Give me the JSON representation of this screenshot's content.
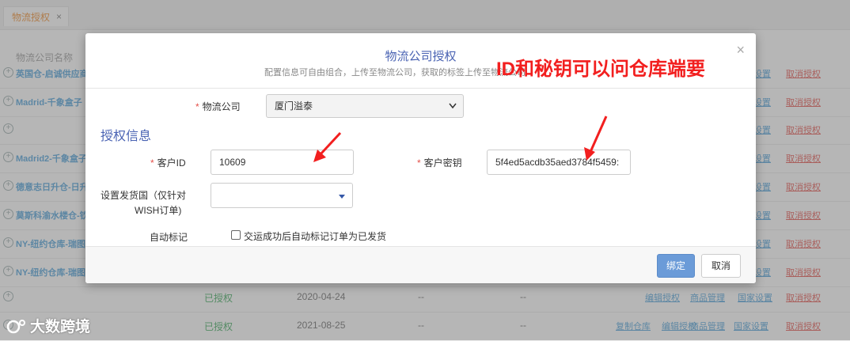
{
  "tab": {
    "label": "物流授权",
    "close_glyph": "×"
  },
  "background": {
    "header_name": "物流公司名称",
    "rows": [
      {
        "name": "英国仓-启诚供应商",
        "auth": "",
        "date": "",
        "d1": "",
        "d2": "",
        "links": [
          "国家设置",
          "取消授权"
        ]
      },
      {
        "name": "Madrid-千象盒子",
        "auth": "",
        "date": "",
        "d1": "",
        "d2": "",
        "links": [
          "国家设置",
          "取消授权"
        ]
      },
      {
        "name": "",
        "auth": "",
        "date": "",
        "d1": "",
        "d2": "",
        "links": [
          "国家设置",
          "取消授权"
        ]
      },
      {
        "name": "Madrid2-千象盒子",
        "auth": "",
        "date": "",
        "d1": "",
        "d2": "",
        "links": [
          "国家设置",
          "取消授权"
        ]
      },
      {
        "name": "德意志日升仓-日升",
        "auth": "",
        "date": "",
        "d1": "",
        "d2": "",
        "links": [
          "国家设置",
          "取消授权"
        ]
      },
      {
        "name": "莫斯科渝水楼仓-钦",
        "auth": "",
        "date": "",
        "d1": "",
        "d2": "",
        "links": [
          "国家设置",
          "取消授权"
        ]
      },
      {
        "name": "NY-纽约仓库-瑞图",
        "auth": "",
        "date": "",
        "d1": "",
        "d2": "",
        "links": [
          "国家设置",
          "取消授权"
        ]
      },
      {
        "name": "NY-纽约仓库-瑞图",
        "auth": "",
        "date": "",
        "d1": "",
        "d2": "",
        "links": [
          "国家设置",
          "取消授权"
        ]
      },
      {
        "name": "",
        "auth": "已授权",
        "date": "2020-04-24",
        "d1": "--",
        "d2": "--",
        "links": [
          "编辑授权",
          "商品管理",
          "国家设置",
          "取消授权"
        ]
      },
      {
        "name": "",
        "auth": "已授权",
        "date": "2021-08-25",
        "d1": "--",
        "d2": "--",
        "links": [
          "复制仓库",
          "编辑授权",
          "商品管理",
          "国家设置",
          "取消授权"
        ]
      }
    ]
  },
  "modal": {
    "title": "物流公司授权",
    "subtitle": "配置信息可自由组合，上传至物流公司，获取的标签上传至物流公司",
    "close_glyph": "×",
    "company_label": "物流公司",
    "company_value": "厦门溢泰",
    "section_title": "授权信息",
    "customer_id_label": "客户ID",
    "customer_id_value": "10609",
    "customer_key_label": "客户密钥",
    "customer_key_value": "5f4ed5acdb35aed3784f5459:",
    "country_label_line1": "设置发货国（仅针对",
    "country_label_line2": "WISH订单)",
    "auto_mark_label": "自动标记",
    "auto_mark_text": "交运成功后自动标记订单为已发货",
    "auto_mark_checked": false,
    "bind_button": "绑定",
    "cancel_button": "取消"
  },
  "annotation": {
    "text": "ID和秘钥可以问仓库端要",
    "color": "#f21f1f"
  },
  "watermark": {
    "text": "大数跨境"
  },
  "colors": {
    "accent_blue": "#4a63b3",
    "primary_button": "#6b9bd8",
    "required": "#e4504a",
    "tab_active": "#f08b2a"
  }
}
